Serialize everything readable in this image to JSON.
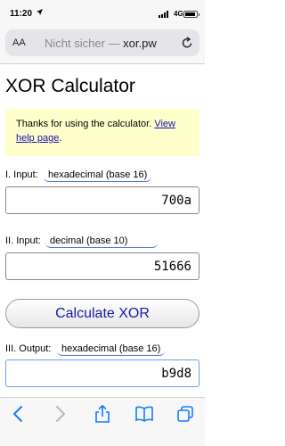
{
  "status_bar": {
    "time": "11:20",
    "network": "4G"
  },
  "browser": {
    "text_size_label": "AA",
    "url_prefix": "Nicht sicher — ",
    "url_domain": "xor.pw"
  },
  "page": {
    "title": "XOR Calculator",
    "notice_text": "Thanks for using the calculator. ",
    "notice_link": "View help page",
    "notice_end": ".",
    "input1": {
      "label": "I. Input:",
      "format": "hexadecimal (base 16)",
      "value": "700a"
    },
    "input2": {
      "label": "II. Input:",
      "format": "decimal (base 10)",
      "value": "51666"
    },
    "calculate_label": "Calculate XOR",
    "output": {
      "label": "III. Output:",
      "format": "hexadecimal (base 16)",
      "value": "b9d8"
    }
  },
  "colors": {
    "accent": "#1a1aa6",
    "link": "#1a0dab",
    "notice_bg": "#ffffcc",
    "ios_blue": "#147efb"
  },
  "toolbar_icons": [
    "back-icon",
    "forward-icon",
    "share-icon",
    "bookmarks-icon",
    "tabs-icon"
  ]
}
